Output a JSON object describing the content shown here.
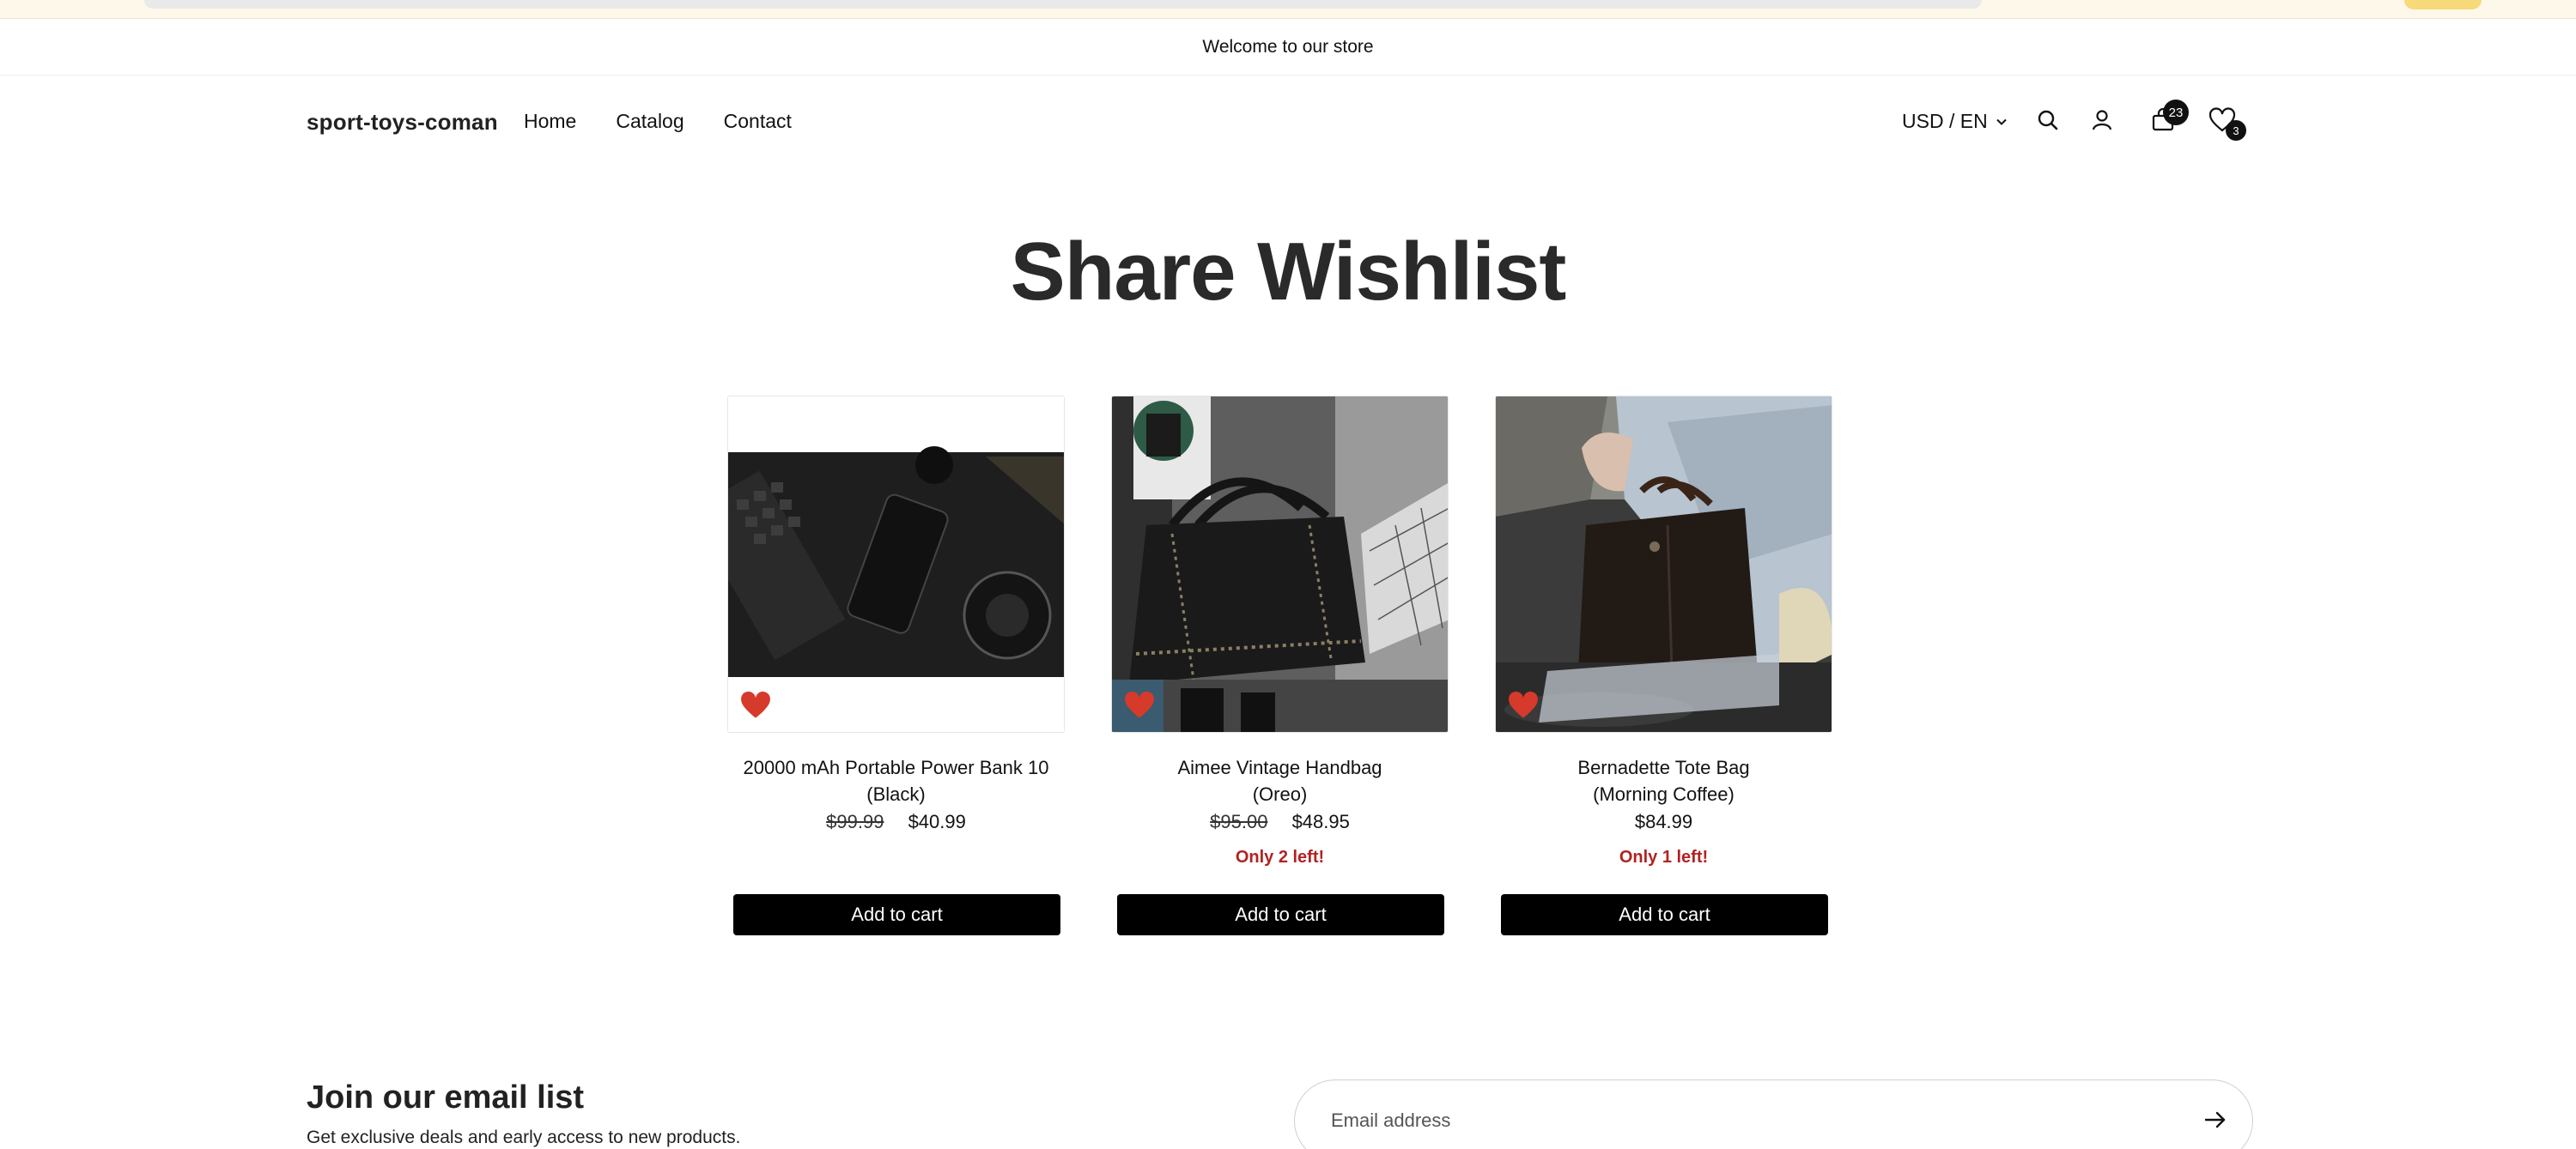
{
  "announcement": "Welcome to our store",
  "header": {
    "logo": "sport-toys-coman",
    "nav": [
      "Home",
      "Catalog",
      "Contact"
    ],
    "locale": "USD / EN",
    "cart_count": "23",
    "wishlist_count": "3"
  },
  "page": {
    "title": "Share Wishlist"
  },
  "products": [
    {
      "name_line1": "20000 mAh Portable Power Bank 10",
      "name_line2": "(Black)",
      "old_price": "$99.99",
      "price": "$40.99",
      "stock": "",
      "button": "Add to cart"
    },
    {
      "name_line1": "Aimee Vintage Handbag",
      "name_line2": "(Oreo)",
      "old_price": "$95.00",
      "price": "$48.95",
      "stock": "Only 2 left!",
      "button": "Add to cart"
    },
    {
      "name_line1": "Bernadette Tote Bag",
      "name_line2": "(Morning Coffee)",
      "old_price": "",
      "price": "$84.99",
      "stock": "Only 1 left!",
      "button": "Add to cart"
    }
  ],
  "newsletter": {
    "title": "Join our email list",
    "subtitle": "Get exclusive deals and early access to new products.",
    "placeholder": "Email address"
  },
  "icons": {
    "search": "search-icon",
    "account": "account-icon",
    "cart": "cart-icon",
    "wishlist": "heart-icon",
    "submit": "arrow-right-icon"
  },
  "colors": {
    "accent_heart": "#d63a2a",
    "stock_text": "#b22222",
    "button_bg": "#000000"
  }
}
